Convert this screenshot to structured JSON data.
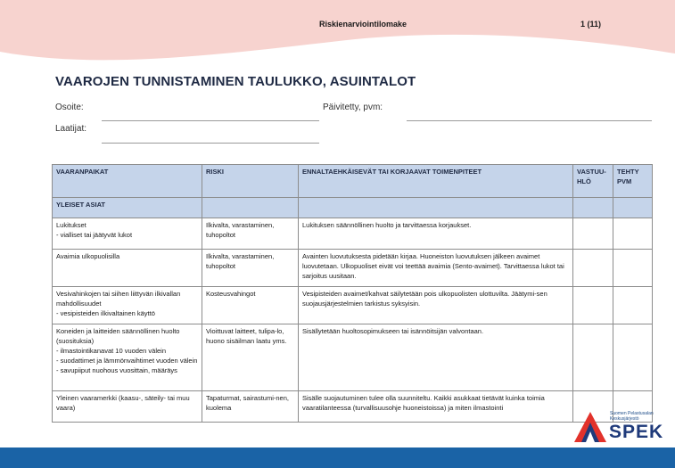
{
  "header": {
    "form_title": "Riskienarviointilomake",
    "page": "1 (11)"
  },
  "doc": {
    "title": "VAAROJEN TUNNISTAMINEN TAULUKKO, ASUINTALOT"
  },
  "fields": {
    "address": "Osoite:",
    "updated": "Päivitetty, pvm:",
    "authors": "Laatijat:"
  },
  "table": {
    "headers": [
      "VAARANPAIKAT",
      "RISKI",
      "ENNALTAEHKÄISEVÄT TAI KORJAAVAT TOIMENPITEET",
      "VASTUU-HLÖ",
      "TEHTY PVM"
    ],
    "section": "YLEISET ASIAT",
    "rows": [
      {
        "place": "Lukitukset\n - vialliset tai jäätyvät lukot",
        "risk": "Ilkivalta, varastaminen, tuhopoltot",
        "action": "Lukituksen säännöllinen huolto ja tarvittaessa korjaukset."
      },
      {
        "place": "Avaimia ulkopuolisilla",
        "risk": "Ilkivalta, varastaminen, tuhopoltot",
        "action": "Avainten luovutuksesta pidetään kirjaa. Huoneiston luovutuksen jälkeen avaimet luovutetaan. Ulkopuoliset eivät voi teettää avaimia (Sento-avaimet). Tarvittaessa lukot tai sarjoitus uusitaan."
      },
      {
        "place": "Vesivahinkojen tai siihen liittyvän ilkivallan mahdollisuudet\n- vesipisteiden ilkivaltainen käyttö",
        "risk": "Kosteusvahingot",
        "action": "Vesipisteiden avaimet/kahvat säilytetään pois ulkopuolisten ulottuvilta. Jäätymi-sen suojausjärjestelmien tarkistus syksyisin."
      },
      {
        "place": "Koneiden ja laitteiden säännöllinen huolto (suosituksia)\n- ilmastointikanavat 10 vuoden välein\n- suodattimet ja lämmönvaihtimet vuoden välein\n- savupiiput nuohous vuosittain, määräys",
        "risk": "Vioittuvat laitteet, tulipa-lo, huono sisäilman laatu yms.",
        "action": "Sisällytetään huoltosopimukseen tai isännöitsijän valvontaan."
      },
      {
        "place": "Yleinen vaaramerkki (kaasu-, säteily- tai muu vaara)",
        "risk": "Tapaturmat, sairastumi-nen, kuolema",
        "action": "Sisälle suojautuminen tulee olla suunniteltu. Kaikki asukkaat tietävät kuinka toimia vaaratilanteessa (turvallisuusohje huoneistoissa) ja miten ilmastointi"
      }
    ]
  },
  "logo": {
    "org_line1": "Suomen Pelastusalan",
    "org_line2": "Keskusjärjestö",
    "name": "SPEK"
  },
  "colors": {
    "wave": "#f7d3cf",
    "table_header": "#c5d4ea",
    "footer": "#1a63a6",
    "logo_red": "#e2322b",
    "logo_blue": "#1f3a7a"
  }
}
